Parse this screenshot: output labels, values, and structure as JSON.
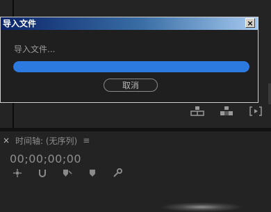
{
  "dialog": {
    "title": "导入文件",
    "close_label": "×",
    "message": "导入文件...",
    "progress": 1.0,
    "cancel_label": "取消",
    "accent_color": "#2c7ae0"
  },
  "timeline": {
    "close_label": "×",
    "title": "时间轴: (无序列)",
    "menu_icon": "≡",
    "timecode": "00;00;00;00"
  },
  "top_tools": [
    "insert-icon",
    "overwrite-icon",
    "export-frame-icon"
  ],
  "timeline_tools": [
    "snap-icon",
    "linked-selection-icon",
    "add-marker-icon",
    "marker-icon",
    "settings-wrench-icon"
  ]
}
